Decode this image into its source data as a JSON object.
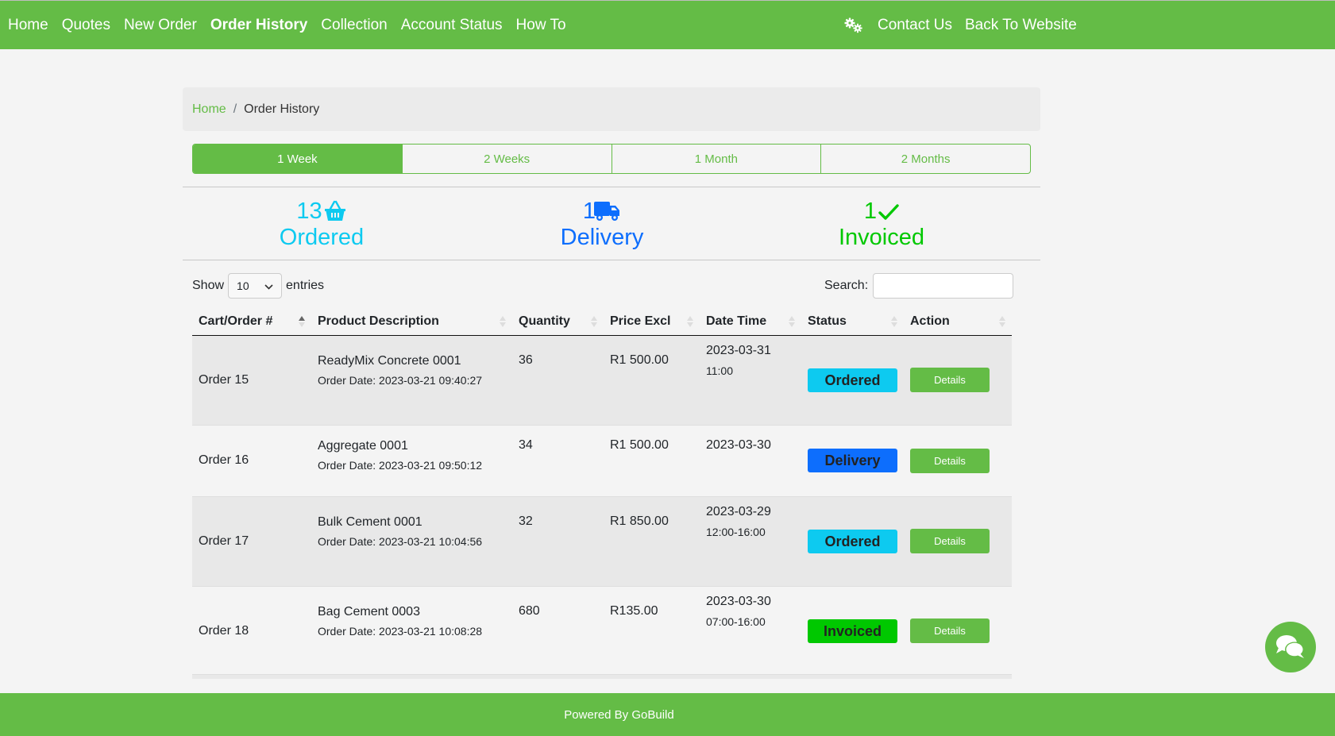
{
  "nav": {
    "left": [
      {
        "label": "Home",
        "active": false
      },
      {
        "label": "Quotes",
        "active": false
      },
      {
        "label": "New Order",
        "active": false
      },
      {
        "label": "Order History",
        "active": true
      },
      {
        "label": "Collection",
        "active": false
      },
      {
        "label": "Account Status",
        "active": false
      },
      {
        "label": "How To",
        "active": false
      }
    ],
    "settings_icon": "gears-icon",
    "right": [
      {
        "label": "Contact Us"
      },
      {
        "label": "Back To Website"
      }
    ]
  },
  "breadcrumb": {
    "home": "Home",
    "separator": "/",
    "current": "Order History"
  },
  "period_tabs": [
    {
      "label": "1 Week",
      "active": true
    },
    {
      "label": "2 Weeks",
      "active": false
    },
    {
      "label": "1 Month",
      "active": false
    },
    {
      "label": "2 Months",
      "active": false
    }
  ],
  "stats": {
    "ordered": {
      "count": "13",
      "label": "Ordered",
      "icon": "basket-icon",
      "color": "#0dcaf0"
    },
    "delivery": {
      "count": "1",
      "label": "Delivery",
      "icon": "truck-icon",
      "color": "#0d6efd"
    },
    "invoiced": {
      "count": "1",
      "label": "Invoiced",
      "icon": "check-icon",
      "color": "#00c800"
    }
  },
  "table_controls": {
    "show_label": "Show",
    "entries_value": "10",
    "entries_label": "entries",
    "search_label": "Search:",
    "search_value": ""
  },
  "table": {
    "columns": [
      "Cart/Order #",
      "Product Description",
      "Quantity",
      "Price Excl",
      "Date Time",
      "Status",
      "Action"
    ],
    "rows": [
      {
        "order": "Order 15",
        "product": "ReadyMix Concrete 0001",
        "order_date": "Order Date: 2023-03-21 09:40:27",
        "quantity": "36",
        "price": "R1 500.00",
        "date": "2023-03-31",
        "time": "11:00",
        "status": "Ordered",
        "action": "Details"
      },
      {
        "order": "Order 16",
        "product": "Aggregate 0001",
        "order_date": "Order Date: 2023-03-21 09:50:12",
        "quantity": "34",
        "price": "R1 500.00",
        "date": "2023-03-30",
        "time": "",
        "status": "Delivery",
        "action": "Details"
      },
      {
        "order": "Order 17",
        "product": "Bulk Cement 0001",
        "order_date": "Order Date: 2023-03-21 10:04:56",
        "quantity": "32",
        "price": "R1 850.00",
        "date": "2023-03-29",
        "time": "12:00-16:00",
        "status": "Ordered",
        "action": "Details"
      },
      {
        "order": "Order 18",
        "product": "Bag Cement 0003",
        "order_date": "Order Date: 2023-03-21 10:08:28",
        "quantity": "680",
        "price": "R135.00",
        "date": "2023-03-30",
        "time": "07:00-16:00",
        "status": "Invoiced",
        "action": "Details"
      }
    ]
  },
  "colors": {
    "brand_green": "#64bc46",
    "ordered": "#0dcaf0",
    "delivery": "#0d6efd",
    "invoiced": "#00c800"
  },
  "footer": {
    "text": "Powered By GoBuild"
  },
  "chat": {
    "icon": "chat-bubbles-icon"
  }
}
